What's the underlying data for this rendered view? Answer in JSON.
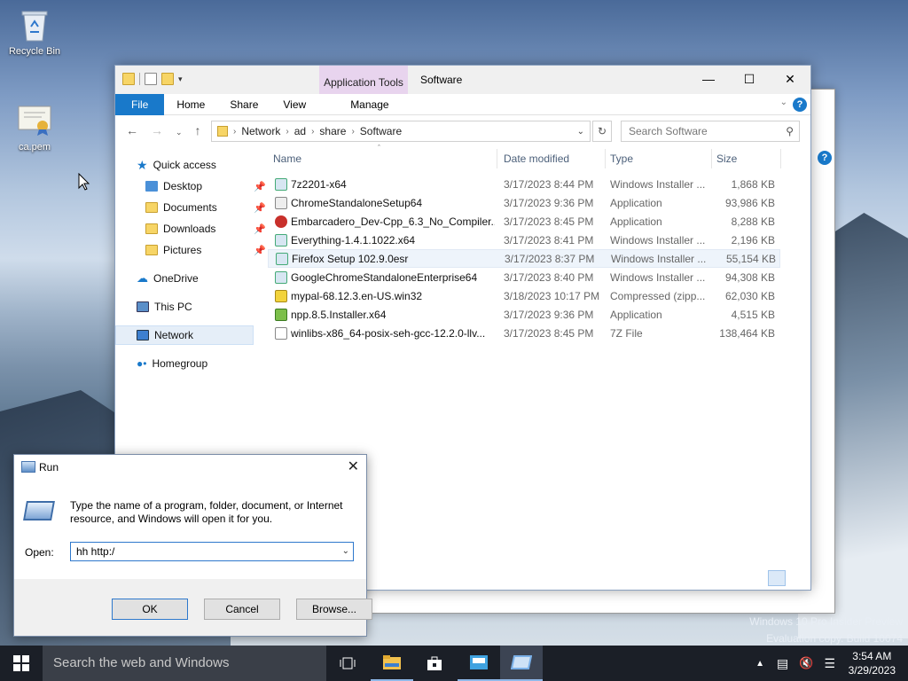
{
  "desktop": {
    "icons": [
      {
        "label": "Recycle Bin",
        "icon": "recycle-bin-icon"
      },
      {
        "label": "ca.pem",
        "icon": "certificate-icon"
      }
    ],
    "watermark_line1": "Windows 10 Pro Insider Preview",
    "watermark_line2": "Evaluation copy. Build 10074"
  },
  "explorer": {
    "context_tab": "Application Tools",
    "title": "Software",
    "ribbon_tabs": [
      "File",
      "Home",
      "Share",
      "View",
      "Manage"
    ],
    "breadcrumb": [
      "Network",
      "ad",
      "share",
      "Software"
    ],
    "search_placeholder": "Search Software",
    "sidebar": [
      {
        "label": "Quick access",
        "icon": "star-icon"
      },
      {
        "label": "Desktop",
        "icon": "folder-icon",
        "pinned": true
      },
      {
        "label": "Documents",
        "icon": "documents-icon",
        "pinned": true
      },
      {
        "label": "Downloads",
        "icon": "downloads-icon",
        "pinned": true
      },
      {
        "label": "Pictures",
        "icon": "pictures-icon",
        "pinned": true
      },
      {
        "label": "OneDrive",
        "icon": "cloud-icon"
      },
      {
        "label": "This PC",
        "icon": "computer-icon"
      },
      {
        "label": "Network",
        "icon": "network-icon",
        "selected": true
      },
      {
        "label": "Homegroup",
        "icon": "homegroup-icon"
      }
    ],
    "columns": [
      "Name",
      "Date modified",
      "Type",
      "Size"
    ],
    "files": [
      {
        "name": "7z2201-x64",
        "date": "3/17/2023 8:44 PM",
        "type": "Windows Installer ...",
        "size": "1,868 KB",
        "icon": "installer-icon"
      },
      {
        "name": "ChromeStandaloneSetup64",
        "date": "3/17/2023 9:36 PM",
        "type": "Application",
        "size": "93,986 KB",
        "icon": "application-icon"
      },
      {
        "name": "Embarcadero_Dev-Cpp_6.3_No_Compiler...",
        "date": "3/17/2023 8:45 PM",
        "type": "Application",
        "size": "8,288 KB",
        "icon": "devcpp-icon"
      },
      {
        "name": "Everything-1.4.1.1022.x64",
        "date": "3/17/2023 8:41 PM",
        "type": "Windows Installer ...",
        "size": "2,196 KB",
        "icon": "installer-icon"
      },
      {
        "name": "Firefox Setup 102.9.0esr",
        "date": "3/17/2023 8:37 PM",
        "type": "Windows Installer ...",
        "size": "55,154 KB",
        "icon": "installer-icon",
        "highlighted": true
      },
      {
        "name": "GoogleChromeStandaloneEnterprise64",
        "date": "3/17/2023 8:40 PM",
        "type": "Windows Installer ...",
        "size": "94,308 KB",
        "icon": "installer-icon"
      },
      {
        "name": "mypal-68.12.3.en-US.win32",
        "date": "3/18/2023 10:17 PM",
        "type": "Compressed (zipp...",
        "size": "62,030 KB",
        "icon": "zip-icon"
      },
      {
        "name": "npp.8.5.Installer.x64",
        "date": "3/17/2023 9:36 PM",
        "type": "Application",
        "size": "4,515 KB",
        "icon": "notepadpp-icon"
      },
      {
        "name": "winlibs-x86_64-posix-seh-gcc-12.2.0-llv...",
        "date": "3/17/2023 8:45 PM",
        "type": "7Z File",
        "size": "138,464 KB",
        "icon": "file-icon"
      }
    ]
  },
  "run": {
    "title": "Run",
    "description": "Type the name of a program, folder, document, or Internet resource, and Windows will open it for you.",
    "open_label": "Open:",
    "open_value": "hh http:/",
    "ok": "OK",
    "cancel": "Cancel",
    "browse": "Browse..."
  },
  "taskbar": {
    "search_placeholder": "Search the web and Windows",
    "time": "3:54 AM",
    "date": "3/29/2023"
  }
}
